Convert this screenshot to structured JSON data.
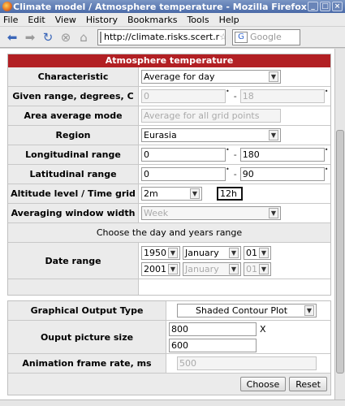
{
  "window": {
    "title": "Climate model / Atmosphere temperature - Mozilla Firefox",
    "controls": [
      "_",
      "□",
      "×"
    ]
  },
  "menubar": {
    "items": [
      "File",
      "Edit",
      "View",
      "History",
      "Bookmarks",
      "Tools",
      "Help"
    ]
  },
  "navbar": {
    "url": "http://climate.risks.scert.r",
    "search_placeholder": "Google"
  },
  "form": {
    "header": "Atmosphere temperature",
    "characteristic": {
      "label": "Characteristic",
      "value": "Average for day"
    },
    "given_range": {
      "label": "Given range, degrees, C",
      "from": "0",
      "to": "18"
    },
    "area_average": {
      "label": "Area average mode",
      "value": "Average for all grid points"
    },
    "region": {
      "label": "Region",
      "value": "Eurasia"
    },
    "longitudinal": {
      "label": "Longitudinal range",
      "from": "0",
      "to": "180"
    },
    "latitudinal": {
      "label": "Latitudinal range",
      "from": "0",
      "to": "90"
    },
    "altitude": {
      "label": "Altitude level / Time grid",
      "level": "2m",
      "time": "12h"
    },
    "averaging": {
      "label": "Averaging window width",
      "value": "Week"
    },
    "date_section_title": "Choose the day and years range",
    "date_range": {
      "label": "Date range",
      "start": {
        "year": "1950",
        "month": "January",
        "day": "01"
      },
      "end": {
        "year": "2001",
        "month": "January",
        "day": "01"
      }
    }
  },
  "output": {
    "graph_type": {
      "label": "Graphical Output Type",
      "value": "Shaded Contour Plot"
    },
    "picture_size": {
      "label": "Ouput picture size",
      "width": "800",
      "x_label": "X",
      "height": "600"
    },
    "frame_rate": {
      "label": "Animation frame rate, ms",
      "value": "500"
    },
    "choose_button": "Choose",
    "reset_button": "Reset"
  }
}
